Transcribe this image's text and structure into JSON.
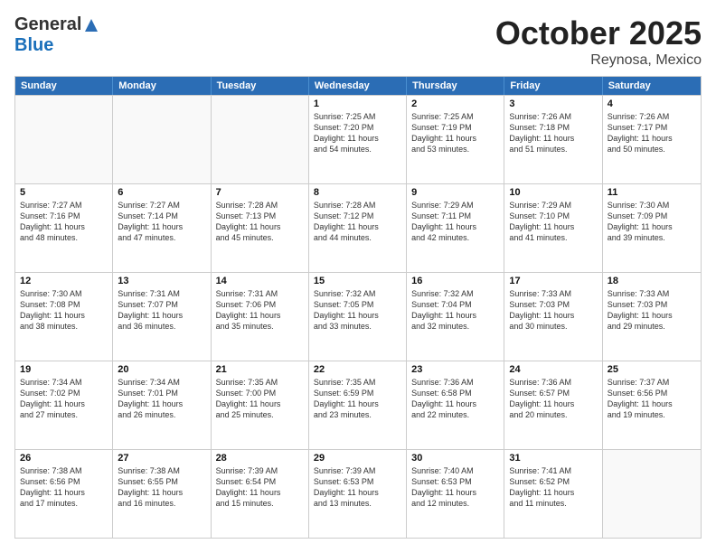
{
  "header": {
    "logo_general": "General",
    "logo_blue": "Blue",
    "month": "October 2025",
    "location": "Reynosa, Mexico"
  },
  "days_of_week": [
    "Sunday",
    "Monday",
    "Tuesday",
    "Wednesday",
    "Thursday",
    "Friday",
    "Saturday"
  ],
  "weeks": [
    [
      {
        "day": "",
        "info": ""
      },
      {
        "day": "",
        "info": ""
      },
      {
        "day": "",
        "info": ""
      },
      {
        "day": "1",
        "info": "Sunrise: 7:25 AM\nSunset: 7:20 PM\nDaylight: 11 hours\nand 54 minutes."
      },
      {
        "day": "2",
        "info": "Sunrise: 7:25 AM\nSunset: 7:19 PM\nDaylight: 11 hours\nand 53 minutes."
      },
      {
        "day": "3",
        "info": "Sunrise: 7:26 AM\nSunset: 7:18 PM\nDaylight: 11 hours\nand 51 minutes."
      },
      {
        "day": "4",
        "info": "Sunrise: 7:26 AM\nSunset: 7:17 PM\nDaylight: 11 hours\nand 50 minutes."
      }
    ],
    [
      {
        "day": "5",
        "info": "Sunrise: 7:27 AM\nSunset: 7:16 PM\nDaylight: 11 hours\nand 48 minutes."
      },
      {
        "day": "6",
        "info": "Sunrise: 7:27 AM\nSunset: 7:14 PM\nDaylight: 11 hours\nand 47 minutes."
      },
      {
        "day": "7",
        "info": "Sunrise: 7:28 AM\nSunset: 7:13 PM\nDaylight: 11 hours\nand 45 minutes."
      },
      {
        "day": "8",
        "info": "Sunrise: 7:28 AM\nSunset: 7:12 PM\nDaylight: 11 hours\nand 44 minutes."
      },
      {
        "day": "9",
        "info": "Sunrise: 7:29 AM\nSunset: 7:11 PM\nDaylight: 11 hours\nand 42 minutes."
      },
      {
        "day": "10",
        "info": "Sunrise: 7:29 AM\nSunset: 7:10 PM\nDaylight: 11 hours\nand 41 minutes."
      },
      {
        "day": "11",
        "info": "Sunrise: 7:30 AM\nSunset: 7:09 PM\nDaylight: 11 hours\nand 39 minutes."
      }
    ],
    [
      {
        "day": "12",
        "info": "Sunrise: 7:30 AM\nSunset: 7:08 PM\nDaylight: 11 hours\nand 38 minutes."
      },
      {
        "day": "13",
        "info": "Sunrise: 7:31 AM\nSunset: 7:07 PM\nDaylight: 11 hours\nand 36 minutes."
      },
      {
        "day": "14",
        "info": "Sunrise: 7:31 AM\nSunset: 7:06 PM\nDaylight: 11 hours\nand 35 minutes."
      },
      {
        "day": "15",
        "info": "Sunrise: 7:32 AM\nSunset: 7:05 PM\nDaylight: 11 hours\nand 33 minutes."
      },
      {
        "day": "16",
        "info": "Sunrise: 7:32 AM\nSunset: 7:04 PM\nDaylight: 11 hours\nand 32 minutes."
      },
      {
        "day": "17",
        "info": "Sunrise: 7:33 AM\nSunset: 7:03 PM\nDaylight: 11 hours\nand 30 minutes."
      },
      {
        "day": "18",
        "info": "Sunrise: 7:33 AM\nSunset: 7:03 PM\nDaylight: 11 hours\nand 29 minutes."
      }
    ],
    [
      {
        "day": "19",
        "info": "Sunrise: 7:34 AM\nSunset: 7:02 PM\nDaylight: 11 hours\nand 27 minutes."
      },
      {
        "day": "20",
        "info": "Sunrise: 7:34 AM\nSunset: 7:01 PM\nDaylight: 11 hours\nand 26 minutes."
      },
      {
        "day": "21",
        "info": "Sunrise: 7:35 AM\nSunset: 7:00 PM\nDaylight: 11 hours\nand 25 minutes."
      },
      {
        "day": "22",
        "info": "Sunrise: 7:35 AM\nSunset: 6:59 PM\nDaylight: 11 hours\nand 23 minutes."
      },
      {
        "day": "23",
        "info": "Sunrise: 7:36 AM\nSunset: 6:58 PM\nDaylight: 11 hours\nand 22 minutes."
      },
      {
        "day": "24",
        "info": "Sunrise: 7:36 AM\nSunset: 6:57 PM\nDaylight: 11 hours\nand 20 minutes."
      },
      {
        "day": "25",
        "info": "Sunrise: 7:37 AM\nSunset: 6:56 PM\nDaylight: 11 hours\nand 19 minutes."
      }
    ],
    [
      {
        "day": "26",
        "info": "Sunrise: 7:38 AM\nSunset: 6:56 PM\nDaylight: 11 hours\nand 17 minutes."
      },
      {
        "day": "27",
        "info": "Sunrise: 7:38 AM\nSunset: 6:55 PM\nDaylight: 11 hours\nand 16 minutes."
      },
      {
        "day": "28",
        "info": "Sunrise: 7:39 AM\nSunset: 6:54 PM\nDaylight: 11 hours\nand 15 minutes."
      },
      {
        "day": "29",
        "info": "Sunrise: 7:39 AM\nSunset: 6:53 PM\nDaylight: 11 hours\nand 13 minutes."
      },
      {
        "day": "30",
        "info": "Sunrise: 7:40 AM\nSunset: 6:53 PM\nDaylight: 11 hours\nand 12 minutes."
      },
      {
        "day": "31",
        "info": "Sunrise: 7:41 AM\nSunset: 6:52 PM\nDaylight: 11 hours\nand 11 minutes."
      },
      {
        "day": "",
        "info": ""
      }
    ]
  ]
}
